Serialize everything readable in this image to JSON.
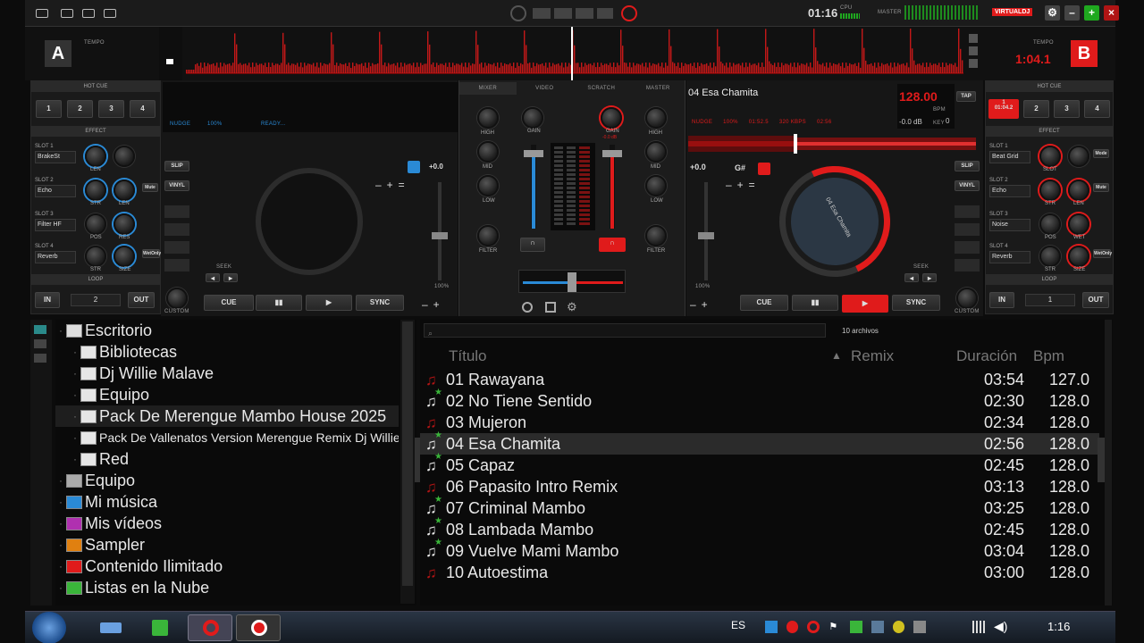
{
  "topbar": {
    "clock": "01:16",
    "cpu_label": "CPU",
    "master_label": "MASTER",
    "brand": "VIRTUALDJ",
    "colors": {
      "red": "#e01b1b",
      "green": "#1fa81f"
    }
  },
  "deckA": {
    "letter": "A",
    "tempo_label": "TEMPO",
    "hotcue_label": "HOT CUE",
    "hotcues": [
      "1",
      "2",
      "3",
      "4"
    ],
    "effect_label": "EFFECT",
    "slots": [
      {
        "label": "SLOT 1",
        "value": "BrakeSt",
        "k1": "LEN"
      },
      {
        "label": "SLOT 2",
        "value": "Echo",
        "k1": "STR",
        "k2": "LEN",
        "btn": "Mute"
      },
      {
        "label": "SLOT 3",
        "value": "Filter HF",
        "k1": "POS",
        "k2": "RES"
      },
      {
        "label": "SLOT 4",
        "value": "Reverb",
        "k1": "STR",
        "k2": "SIZE",
        "btn": "WetOnly"
      }
    ],
    "loop_label": "LOOP",
    "loop_in": "IN",
    "loop_out": "OUT",
    "loop_value": "2",
    "nudge": "NUDGE",
    "percent": "100%",
    "status": "READY...",
    "slip": "SLIP",
    "vinyl": "VINYL",
    "pitch": "+0.0",
    "pitch_pct": "100%",
    "seek": "SEEK",
    "cue": "CUE",
    "sync": "SYNC",
    "custom": "CUSTOM"
  },
  "mixer": {
    "tabs": [
      "MIXER",
      "VIDEO",
      "SCRATCH",
      "MASTER"
    ],
    "left_knobs": [
      "HIGH",
      "MID",
      "LOW",
      "FILTER"
    ],
    "right_knobs": [
      "HIGH",
      "MID",
      "LOW",
      "FILTER"
    ],
    "gain": "GAIN",
    "gain_db": "-0.0 dB"
  },
  "deckB": {
    "letter": "B",
    "tempo_label": "TEMPO",
    "time": "1:04.1",
    "title": "04 Esa Chamita",
    "bpm": "128.00",
    "bpm_label": "BPM",
    "tap": "TAP",
    "db": "-0.0 dB",
    "key_label": "KEY",
    "key_value": "0",
    "info": [
      "NUDGE",
      "100%",
      "01:52.5",
      "320 KBPS",
      "02:56"
    ],
    "key": "G#",
    "pitch": "+0.0",
    "pitch_pct": "100%",
    "hotcue_label": "HOT CUE",
    "hotcue1": "1",
    "hotcue1_time": "01:04.2",
    "hotcues": [
      "2",
      "3",
      "4"
    ],
    "effect_label": "EFFECT",
    "slots": [
      {
        "label": "SLOT 1",
        "value": "Beat Grid",
        "k1": "SLOT",
        "btn": "Mode"
      },
      {
        "label": "SLOT 2",
        "value": "Echo",
        "k1": "STR",
        "k2": "LEN",
        "btn": "Mute"
      },
      {
        "label": "SLOT 3",
        "value": "Noise",
        "k1": "POS",
        "k2": "WET"
      },
      {
        "label": "SLOT 4",
        "value": "Reverb",
        "k1": "STR",
        "k2": "SIZE",
        "btn": "WetOnly"
      }
    ],
    "loop_label": "LOOP",
    "loop_in": "IN",
    "loop_out": "OUT",
    "loop_value": "1",
    "platter_text": "04 Esa Chamita",
    "slip": "SLIP",
    "vinyl": "VINYL",
    "seek": "SEEK",
    "cue": "CUE",
    "sync": "SYNC",
    "custom": "CUSTOM"
  },
  "browser": {
    "folders": [
      {
        "name": "Escritorio",
        "indent": 0,
        "type": "desktop"
      },
      {
        "name": "Bibliotecas",
        "indent": 1,
        "type": "folder"
      },
      {
        "name": "Dj Willie Malave",
        "indent": 1,
        "type": "folder"
      },
      {
        "name": "Equipo",
        "indent": 1,
        "type": "folder"
      },
      {
        "name": "Pack De Merengue Mambo House 2025",
        "indent": 1,
        "type": "folder",
        "selected": true
      },
      {
        "name": "Pack De Vallenatos Version Merengue Remix Dj Willie Ma",
        "indent": 1,
        "type": "folder",
        "small": true
      },
      {
        "name": "Red",
        "indent": 1,
        "type": "folder"
      },
      {
        "name": "Equipo",
        "indent": 0,
        "type": "computer"
      },
      {
        "name": "Mi música",
        "indent": 0,
        "type": "music"
      },
      {
        "name": "Mis vídeos",
        "indent": 0,
        "type": "video"
      },
      {
        "name": "Sampler",
        "indent": 0,
        "type": "sampler"
      },
      {
        "name": "Contenido Ilimitado",
        "indent": 0,
        "type": "content"
      },
      {
        "name": "Listas en la Nube",
        "indent": 0,
        "type": "cloud"
      }
    ],
    "search_placeholder": "",
    "file_count": "10 archivos",
    "columns": {
      "title": "Título",
      "remix": "Remix",
      "duration": "Duración",
      "bpm": "Bpm"
    },
    "tracks": [
      {
        "title": "01 Rawayana",
        "duration": "03:54",
        "bpm": "127.0",
        "star": false
      },
      {
        "title": "02 No Tiene Sentido",
        "duration": "02:30",
        "bpm": "128.0",
        "star": true
      },
      {
        "title": "03 Mujeron",
        "duration": "02:34",
        "bpm": "128.0",
        "star": false
      },
      {
        "title": "04 Esa Chamita",
        "duration": "02:56",
        "bpm": "128.0",
        "star": true,
        "selected": true
      },
      {
        "title": "05 Capaz",
        "duration": "02:45",
        "bpm": "128.0",
        "star": true
      },
      {
        "title": "06 Papasito Intro Remix",
        "duration": "03:13",
        "bpm": "128.0",
        "star": false
      },
      {
        "title": "07 Criminal Mambo",
        "duration": "03:25",
        "bpm": "128.0",
        "star": true
      },
      {
        "title": "08 Lambada Mambo",
        "duration": "02:45",
        "bpm": "128.0",
        "star": true
      },
      {
        "title": "09 Vuelve Mami Mambo",
        "duration": "03:04",
        "bpm": "128.0",
        "star": true
      },
      {
        "title": "10 Autoestima",
        "duration": "03:00",
        "bpm": "128.0",
        "star": false
      }
    ]
  },
  "taskbar": {
    "lang": "ES",
    "clock": "1:16"
  }
}
